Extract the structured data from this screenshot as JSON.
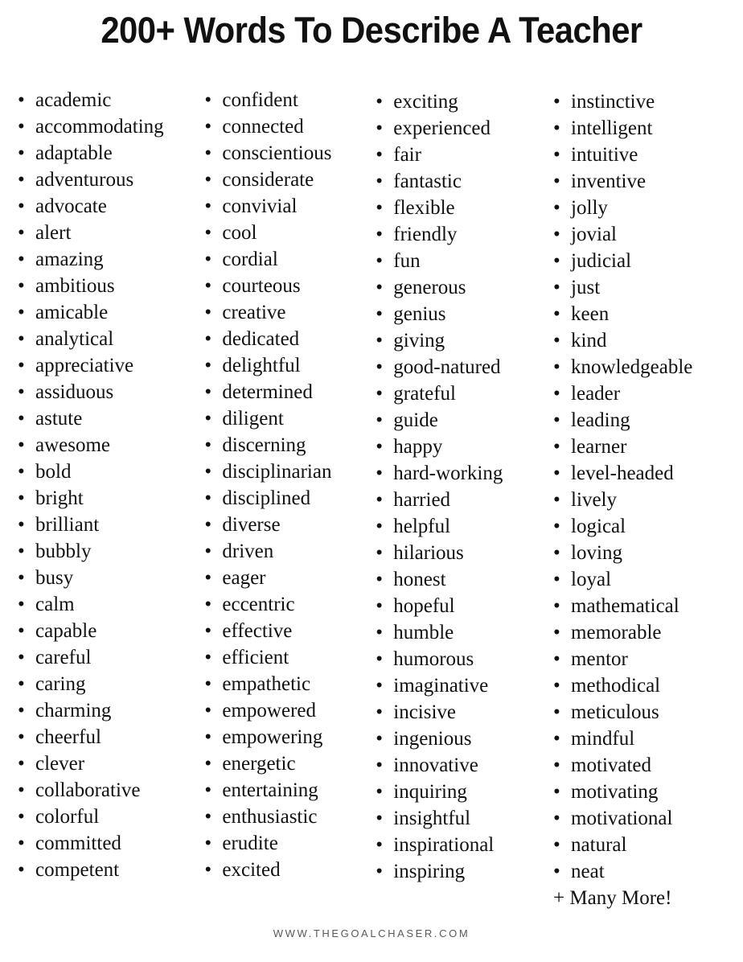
{
  "document": {
    "title": "200+ Words To Describe A Teacher",
    "bullet_glyph": "•",
    "text_color": "#111111",
    "footer_color": "#595959",
    "background_color": "#ffffff"
  },
  "footer": {
    "url": "WWW.THEGOALCHASER.COM"
  },
  "lists": {
    "more_label": "+ Many More!",
    "columns": [
      {
        "id": "column-1",
        "words": [
          "academic",
          "accommodating",
          "adaptable",
          "adventurous",
          "advocate",
          "alert",
          "amazing",
          "ambitious",
          "amicable",
          "analytical",
          "appreciative",
          "assiduous",
          "astute",
          "awesome",
          "bold",
          "bright",
          "brilliant",
          "bubbly",
          "busy",
          "calm",
          "capable",
          "careful",
          "caring",
          "charming",
          "cheerful",
          "clever",
          "collaborative",
          "colorful",
          "committed",
          "competent"
        ]
      },
      {
        "id": "column-2",
        "words": [
          "confident",
          "connected",
          "conscientious",
          "considerate",
          "convivial",
          "cool",
          "cordial",
          "courteous",
          "creative",
          "dedicated",
          "delightful",
          "determined",
          "diligent",
          "discerning",
          "disciplinarian",
          "disciplined",
          "diverse",
          "driven",
          "eager",
          "eccentric",
          "effective",
          "efficient",
          "empathetic",
          "empowered",
          "empowering",
          "energetic",
          "entertaining",
          "enthusiastic",
          "erudite",
          "excited"
        ]
      },
      {
        "id": "column-3",
        "words": [
          "exciting",
          "experienced",
          "fair",
          "fantastic",
          "flexible",
          "friendly",
          "fun",
          "generous",
          "genius",
          "giving",
          "good-natured",
          "grateful",
          "guide",
          "happy",
          "hard-working",
          "harried",
          "helpful",
          "hilarious",
          "honest",
          "hopeful",
          "humble",
          "humorous",
          "imaginative",
          "incisive",
          "ingenious",
          "innovative",
          "inquiring",
          "insightful",
          "inspirational",
          "inspiring"
        ]
      },
      {
        "id": "column-4",
        "words": [
          "instinctive",
          "intelligent",
          "intuitive",
          "inventive",
          "jolly",
          "jovial",
          "judicial",
          "just",
          "keen",
          "kind",
          "knowledgeable",
          "leader",
          "leading",
          "learner",
          "level-headed",
          "lively",
          "logical",
          "loving",
          "loyal",
          "mathematical",
          "memorable",
          "mentor",
          "methodical",
          "meticulous",
          "mindful",
          "motivated",
          "motivating",
          "motivational",
          "natural",
          "neat"
        ],
        "trailing_note": "+ Many More!"
      }
    ]
  }
}
